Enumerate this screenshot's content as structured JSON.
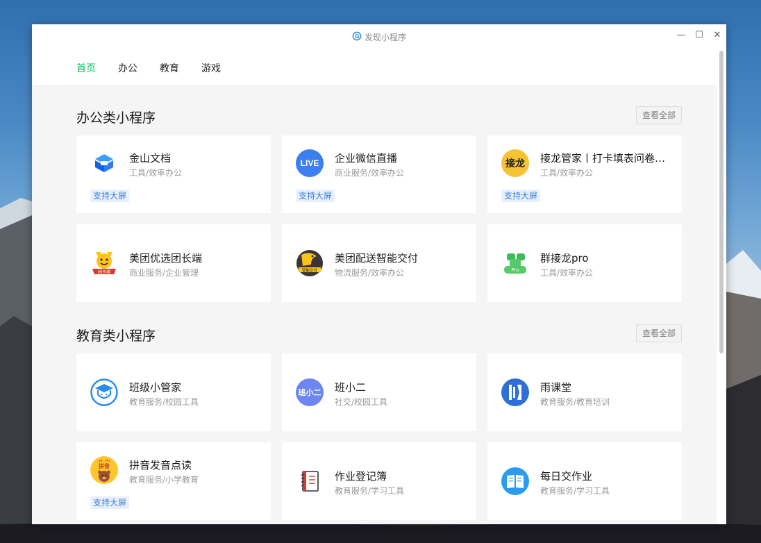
{
  "window": {
    "title": "发现小程序",
    "minimize": "—",
    "maximize": "☐",
    "close": "✕"
  },
  "nav": {
    "tabs": [
      {
        "label": "首页",
        "active": true
      },
      {
        "label": "办公",
        "active": false
      },
      {
        "label": "教育",
        "active": false
      },
      {
        "label": "游戏",
        "active": false
      }
    ]
  },
  "sections": [
    {
      "title": "办公类小程序",
      "view_all": "查看全部",
      "cards": [
        {
          "name": "金山文档",
          "category": "工具/效率办公",
          "tag": "支持大屏",
          "icon": "kingsoft-docs-icon"
        },
        {
          "name": "企业微信直播",
          "category": "商业服务/效率办公",
          "tag": "支持大屏",
          "icon": "live-icon",
          "icon_text": "LIVE"
        },
        {
          "name": "接龙管家丨打卡填表问卷…",
          "category": "工具/效率办公",
          "tag": "支持大屏",
          "icon": "jielong-icon",
          "icon_text": "接龙"
        },
        {
          "name": "美团优选团长端",
          "category": "商业服务/企业管理",
          "tag": "",
          "icon": "meituan-youxuan-icon",
          "icon_text": "团长端"
        },
        {
          "name": "美团配送智能交付",
          "category": "物流服务/效率办公",
          "tag": "",
          "icon": "meituan-delivery-icon",
          "icon_text": "智能交付"
        },
        {
          "name": "群接龙pro",
          "category": "工具/效率办公",
          "tag": "",
          "icon": "qunjielong-icon",
          "icon_text": "Pro"
        }
      ]
    },
    {
      "title": "教育类小程序",
      "view_all": "查看全部",
      "cards": [
        {
          "name": "班级小管家",
          "category": "教育服务/校园工具",
          "tag": "",
          "icon": "student-cap-icon"
        },
        {
          "name": "班小二",
          "category": "社交/校园工具",
          "tag": "",
          "icon": "banxiaoer-icon",
          "icon_text": "班小二"
        },
        {
          "name": "雨课堂",
          "category": "教育服务/教育培训",
          "tag": "",
          "icon": "yuketang-icon"
        },
        {
          "name": "拼音发音点读",
          "category": "教育服务/小学教育",
          "tag": "支持大屏",
          "icon": "pinyin-bear-icon",
          "icon_text": "拼音",
          "icon_small": "pīn yīn"
        },
        {
          "name": "作业登记簿",
          "category": "教育服务/学习工具",
          "tag": "",
          "icon": "notebook-icon"
        },
        {
          "name": "每日交作业",
          "category": "教育服务/学习工具",
          "tag": "",
          "icon": "open-book-icon"
        }
      ]
    }
  ],
  "colors": {
    "accent": "#07c160",
    "tag_text": "#3b7fd6",
    "tag_bg": "#e8f0fb",
    "card_bg": "#ffffff",
    "content_bg": "#f5f5f5"
  }
}
